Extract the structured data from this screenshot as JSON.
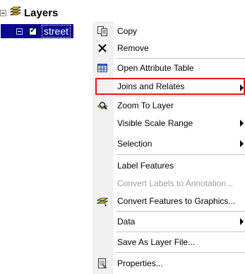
{
  "toc": {
    "root_label": "Layers",
    "layer_label": "street",
    "layer_checked": "✔"
  },
  "context_menu": {
    "items": [
      {
        "label": "Copy",
        "icon": "copy-icon"
      },
      {
        "label": "Remove",
        "icon": "remove-x-icon"
      },
      {
        "label": "Open Attribute Table",
        "icon": "attribute-table-icon"
      },
      {
        "label": "Joins and Relates",
        "submenu": true
      },
      {
        "label": "Zoom To Layer",
        "icon": "zoom-to-layer-icon"
      },
      {
        "label": "Visible Scale Range",
        "submenu": true
      },
      {
        "label": "Selection",
        "submenu": true
      },
      {
        "label": "Label Features"
      },
      {
        "label": "Convert Labels to Annotation...",
        "disabled": true
      },
      {
        "label": "Convert Features to Graphics...",
        "icon": "convert-graphics-icon"
      },
      {
        "label": "Data",
        "submenu": true
      },
      {
        "label": "Save As Layer File..."
      },
      {
        "label": "Properties...",
        "icon": "properties-icon"
      }
    ]
  },
  "colors": {
    "selection": "#0a0a8c",
    "focus_outline": "#e11a1a",
    "layers_icon": "#e7c21a"
  }
}
